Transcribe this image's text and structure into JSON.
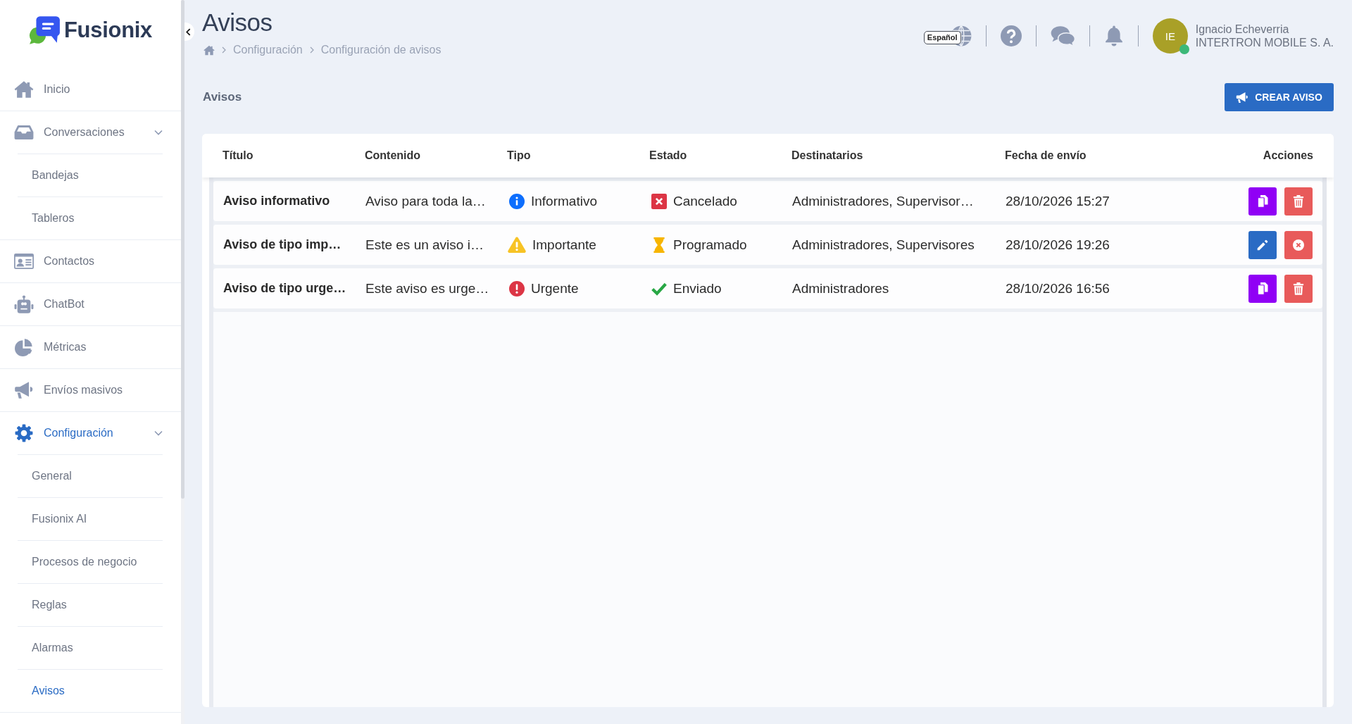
{
  "sidebar": {
    "logo": "Fusionix",
    "items": [
      {
        "label": "Inicio",
        "selected": false
      },
      {
        "label": "Conversaciones",
        "selected": false,
        "expanded": true,
        "children": [
          {
            "label": "Bandejas",
            "selected": false
          },
          {
            "label": "Tableros",
            "selected": false
          }
        ]
      },
      {
        "label": "Contactos",
        "selected": false
      },
      {
        "label": "ChatBot",
        "selected": false
      },
      {
        "label": "Métricas",
        "selected": false
      },
      {
        "label": "Envíos masivos",
        "selected": false
      },
      {
        "label": "Configuración",
        "selected": true,
        "expanded": true,
        "children": [
          {
            "label": "General",
            "selected": false
          },
          {
            "label": "Fusionix AI",
            "selected": false
          },
          {
            "label": "Procesos de negocio",
            "selected": false
          },
          {
            "label": "Reglas",
            "selected": false
          },
          {
            "label": "Alarmas",
            "selected": false
          },
          {
            "label": "Avisos",
            "selected": true
          }
        ]
      }
    ]
  },
  "header": {
    "title": "Avisos",
    "breadcrumb": [
      "Configuración",
      "Configuración de avisos"
    ],
    "language": "Español",
    "user": {
      "initials": "IE",
      "name": "Ignacio Echeverria",
      "company": "INTERTRON MOBILE S. A.",
      "online": true
    }
  },
  "toolbar": {
    "title": "Avisos",
    "button": "CREAR AVISO"
  },
  "table": {
    "columns": [
      "Título",
      "Contenido",
      "Tipo",
      "Estado",
      "Destinatarios",
      "Fecha de envío",
      "Acciones"
    ],
    "rows": [
      {
        "title": "Aviso informativo",
        "content": "Aviso para toda la…",
        "type": {
          "kind": "info",
          "label": "Informativo"
        },
        "status": {
          "kind": "cancelled",
          "label": "Cancelado"
        },
        "recipients": "Administradores, Supervisor…",
        "date": "28/10/2026 15:27",
        "actions": [
          {
            "kind": "duplicate"
          },
          {
            "kind": "delete"
          }
        ]
      },
      {
        "title": "Aviso de tipo imp…",
        "content": "Este es un aviso i…",
        "type": {
          "kind": "warning",
          "label": "Importante"
        },
        "status": {
          "kind": "scheduled",
          "label": "Programado"
        },
        "recipients": "Administradores, Supervisores",
        "date": "28/10/2026 19:26",
        "actions": [
          {
            "kind": "edit"
          },
          {
            "kind": "cancel"
          }
        ]
      },
      {
        "title": "Aviso de tipo urge…",
        "content": "Este aviso es urge…",
        "type": {
          "kind": "urgent",
          "label": "Urgente"
        },
        "status": {
          "kind": "sent",
          "label": "Enviado"
        },
        "recipients": "Administradores",
        "date": "28/10/2026 16:56",
        "actions": [
          {
            "kind": "duplicate"
          },
          {
            "kind": "delete"
          }
        ]
      }
    ]
  }
}
